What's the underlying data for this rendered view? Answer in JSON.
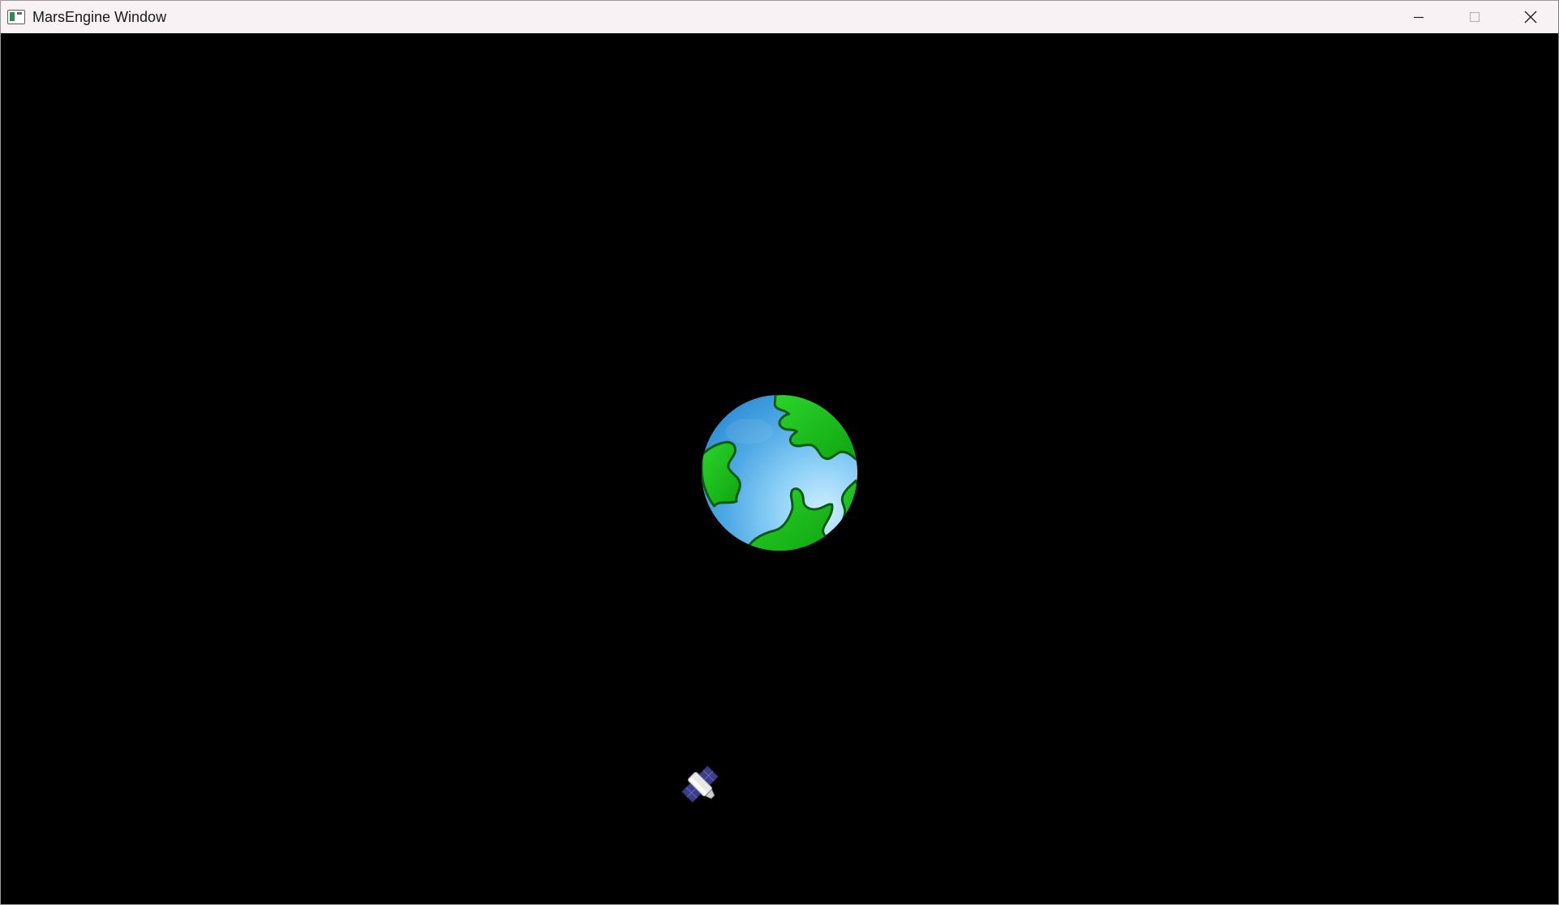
{
  "window": {
    "title": "MarsEngine Window",
    "app_icon": "app-window-icon",
    "controls": {
      "minimize_icon": "minimize-icon",
      "maximize_icon": "maximize-icon",
      "close_icon": "close-icon"
    }
  },
  "scene": {
    "background_color": "#000000",
    "objects": [
      {
        "name": "earth",
        "icon": "earth-icon",
        "colors": [
          "#1ab81a",
          "#4aa6e6",
          "#b8e6ff"
        ]
      },
      {
        "name": "satellite",
        "icon": "satellite-icon",
        "colors": [
          "#3c3c8c",
          "#e6e6e6"
        ]
      }
    ]
  }
}
